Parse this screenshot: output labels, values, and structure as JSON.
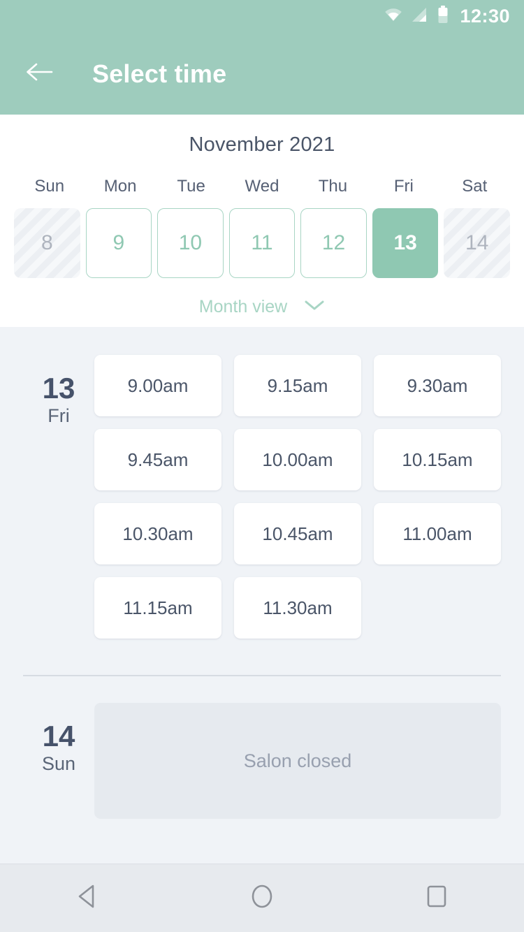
{
  "status_bar": {
    "time": "12:30",
    "icons": [
      "wifi-icon",
      "signal-icon",
      "battery-icon"
    ]
  },
  "app_bar": {
    "back_icon": "back-arrow-icon",
    "title": "Select time"
  },
  "calendar": {
    "month_title": "November 2021",
    "weekday_headers": [
      "Sun",
      "Mon",
      "Tue",
      "Wed",
      "Thu",
      "Fri",
      "Sat"
    ],
    "days": [
      {
        "label": "8",
        "state": "disabled"
      },
      {
        "label": "9",
        "state": "enabled"
      },
      {
        "label": "10",
        "state": "enabled"
      },
      {
        "label": "11",
        "state": "enabled"
      },
      {
        "label": "12",
        "state": "enabled"
      },
      {
        "label": "13",
        "state": "selected"
      },
      {
        "label": "14",
        "state": "disabled"
      }
    ],
    "view_toggle_label": "Month view",
    "view_toggle_icon": "chevron-down-icon"
  },
  "day_groups": [
    {
      "day_number": "13",
      "day_name": "Fri",
      "closed": false,
      "slots": [
        "9.00am",
        "9.15am",
        "9.30am",
        "9.45am",
        "10.00am",
        "10.15am",
        "10.30am",
        "10.45am",
        "11.00am",
        "11.15am",
        "11.30am"
      ]
    },
    {
      "day_number": "14",
      "day_name": "Sun",
      "closed": true,
      "closed_message": "Salon closed",
      "slots": []
    }
  ],
  "nav_bar": {
    "back_icon": "nav-back-triangle-icon",
    "home_icon": "nav-home-circle-icon",
    "recents_icon": "nav-recents-square-icon"
  },
  "colors": {
    "accent_green": "#9ECCBD",
    "selected_green": "#8FC8B2",
    "outline_green": "#A8D5C4",
    "body_bg": "#F0F3F7",
    "text_dark": "#4A5568",
    "text_muted": "#98A0AF",
    "closed_card_bg": "#E6EAEF",
    "nav_bg": "#E7EAEE"
  }
}
